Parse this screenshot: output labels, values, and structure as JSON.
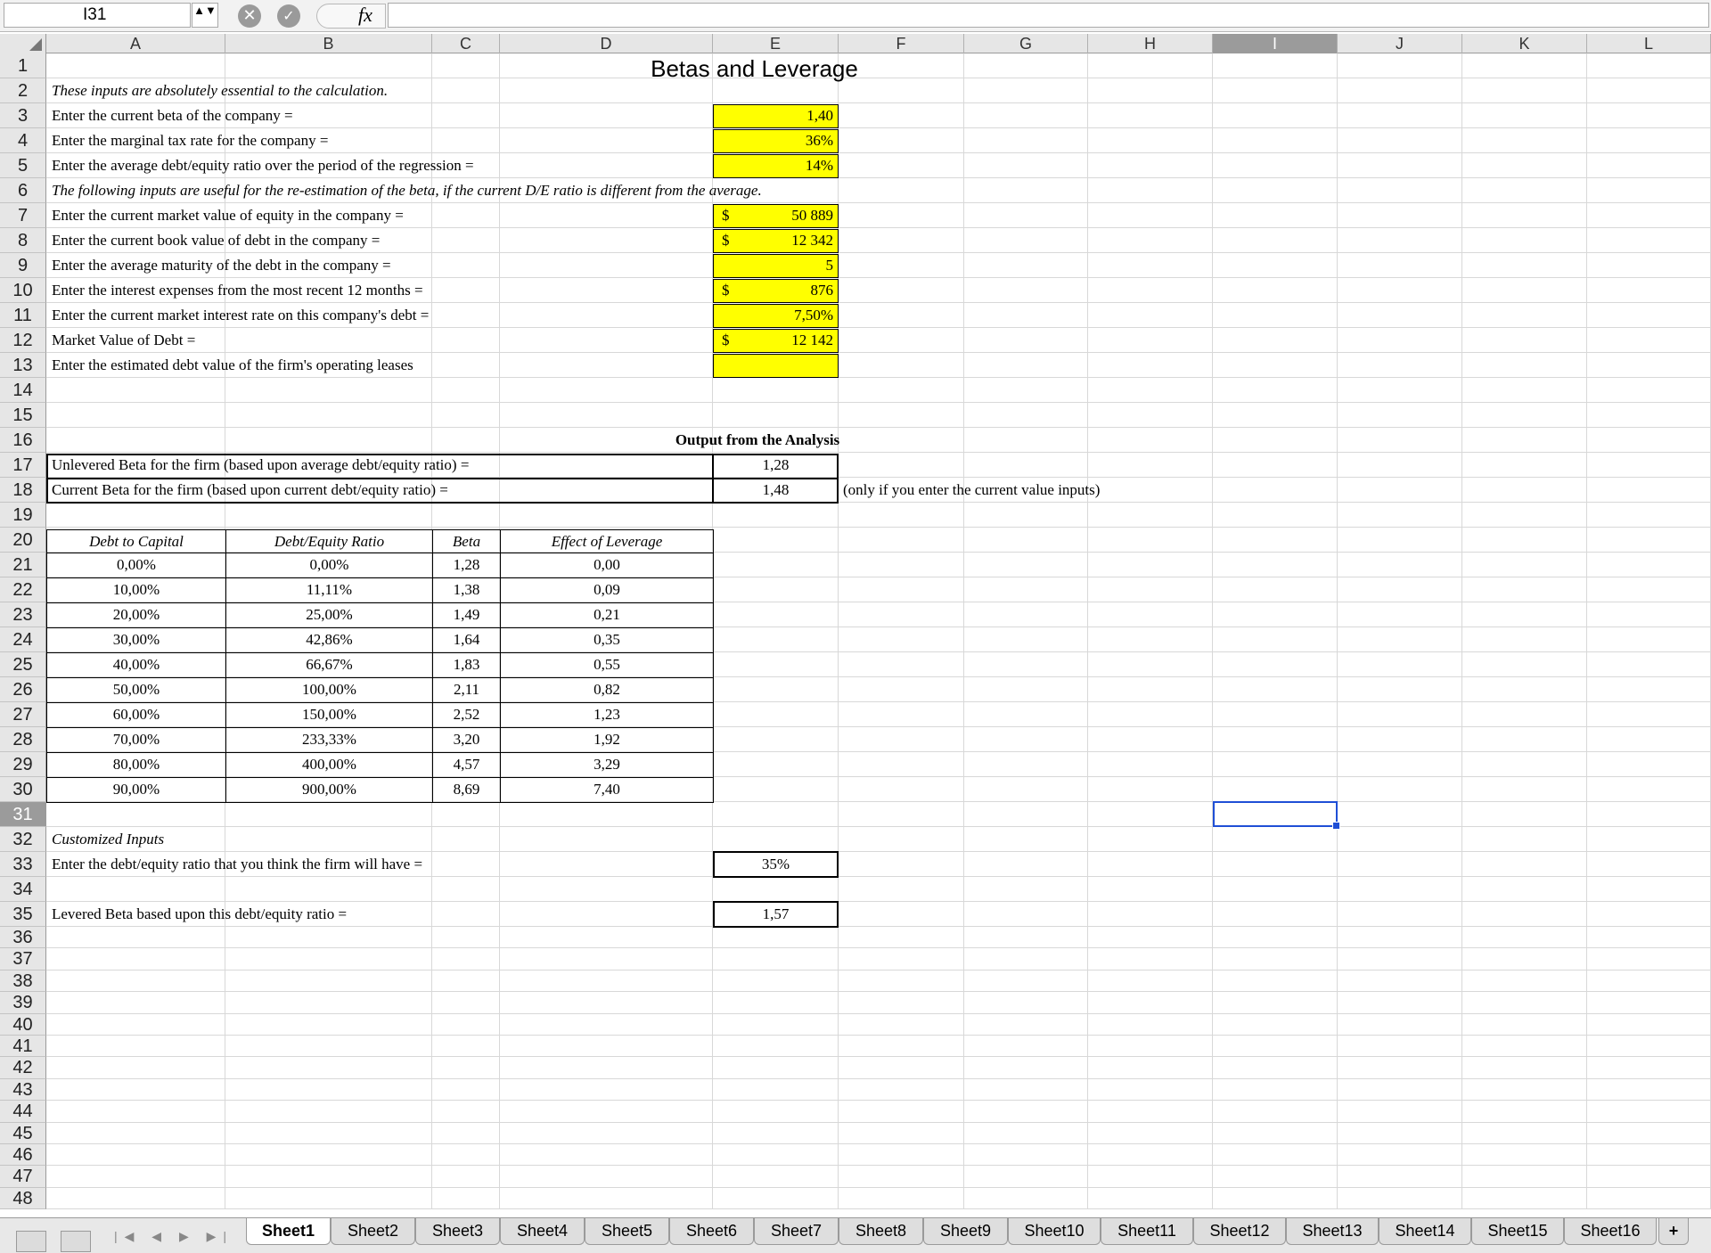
{
  "formula_bar": {
    "name_box": "I31",
    "stepper": "▲▼",
    "cancel_glyph": "✕",
    "confirm_glyph": "✓",
    "fx_label": "fx",
    "formula": ""
  },
  "columns": [
    "A",
    "B",
    "C",
    "D",
    "E",
    "F",
    "G",
    "H",
    "I",
    "J",
    "K",
    "L"
  ],
  "active_column": "I",
  "active_row": 31,
  "title": "Betas and Leverage",
  "inputs_heading": "These inputs are absolutely essential to the calculation.",
  "inputs": [
    {
      "row": 3,
      "label": "Enter the current beta of the company =",
      "dollar": "",
      "value": "1,40"
    },
    {
      "row": 4,
      "label": "Enter the marginal tax rate for the company =",
      "dollar": "",
      "value": "36%"
    },
    {
      "row": 5,
      "label": "Enter the average debt/equity ratio over the period of the regression =",
      "dollar": "",
      "value": "14%"
    }
  ],
  "optional_heading": "The following inputs are useful for the re-estimation of the beta, if the current D/E ratio is different from the average.",
  "optional_inputs": [
    {
      "row": 7,
      "label": "Enter the current market value of equity in the company =",
      "dollar": "$",
      "value": "50 889"
    },
    {
      "row": 8,
      "label": "Enter the current book value of debt in the company =",
      "dollar": "$",
      "value": "12 342"
    },
    {
      "row": 9,
      "label": "Enter the average maturity of the debt in the company =",
      "dollar": "",
      "value": "5"
    },
    {
      "row": 10,
      "label": "Enter the interest expenses from the most recent 12 months =",
      "dollar": "$",
      "value": "876"
    },
    {
      "row": 11,
      "label": "Enter the current market interest rate on this company's debt =",
      "dollar": "",
      "value": "7,50%"
    },
    {
      "row": 12,
      "label": "Market Value of Debt =",
      "dollar": "$",
      "value": "12 142"
    },
    {
      "row": 13,
      "label": "Enter the estimated debt value of the firm's operating leases",
      "dollar": "",
      "value": ""
    }
  ],
  "output_heading": "Output from the Analysis",
  "outputs": [
    {
      "row": 17,
      "label": "Unlevered Beta for the firm (based upon average debt/equity ratio) =",
      "value": "1,28",
      "note": ""
    },
    {
      "row": 18,
      "label": "Current Beta for the firm (based upon current debt/equity ratio) =",
      "value": "1,48",
      "note": "(only if you enter the current value inputs)"
    }
  ],
  "leverage_table": {
    "headers": [
      "Debt to Capital",
      "Debt/Equity Ratio",
      "Beta",
      "Effect of Leverage"
    ],
    "rows": [
      [
        "0,00%",
        "0,00%",
        "1,28",
        "0,00"
      ],
      [
        "10,00%",
        "11,11%",
        "1,38",
        "0,09"
      ],
      [
        "20,00%",
        "25,00%",
        "1,49",
        "0,21"
      ],
      [
        "30,00%",
        "42,86%",
        "1,64",
        "0,35"
      ],
      [
        "40,00%",
        "66,67%",
        "1,83",
        "0,55"
      ],
      [
        "50,00%",
        "100,00%",
        "2,11",
        "0,82"
      ],
      [
        "60,00%",
        "150,00%",
        "2,52",
        "1,23"
      ],
      [
        "70,00%",
        "233,33%",
        "3,20",
        "1,92"
      ],
      [
        "80,00%",
        "400,00%",
        "4,57",
        "3,29"
      ],
      [
        "90,00%",
        "900,00%",
        "8,69",
        "7,40"
      ]
    ]
  },
  "custom_heading": "Customized Inputs",
  "custom_input": {
    "row": 33,
    "label": "Enter the debt/equity ratio that you think the firm will have =",
    "value": "35%"
  },
  "custom_output": {
    "row": 35,
    "label": "Levered Beta based upon this debt/equity ratio =",
    "value": "1,57"
  },
  "tab_nav_glyphs": "|◀ ◀ ▶ ▶|",
  "tabs": [
    "Sheet1",
    "Sheet2",
    "Sheet3",
    "Sheet4",
    "Sheet5",
    "Sheet6",
    "Sheet7",
    "Sheet8",
    "Sheet9",
    "Sheet10",
    "Sheet11",
    "Sheet12",
    "Sheet13",
    "Sheet14",
    "Sheet15",
    "Sheet16"
  ],
  "active_tab": "Sheet1",
  "add_tab_label": "+",
  "colors": {
    "input_fill": "#ffff00",
    "selection": "#1f4fd6",
    "header_active": "#9b9b9b"
  }
}
